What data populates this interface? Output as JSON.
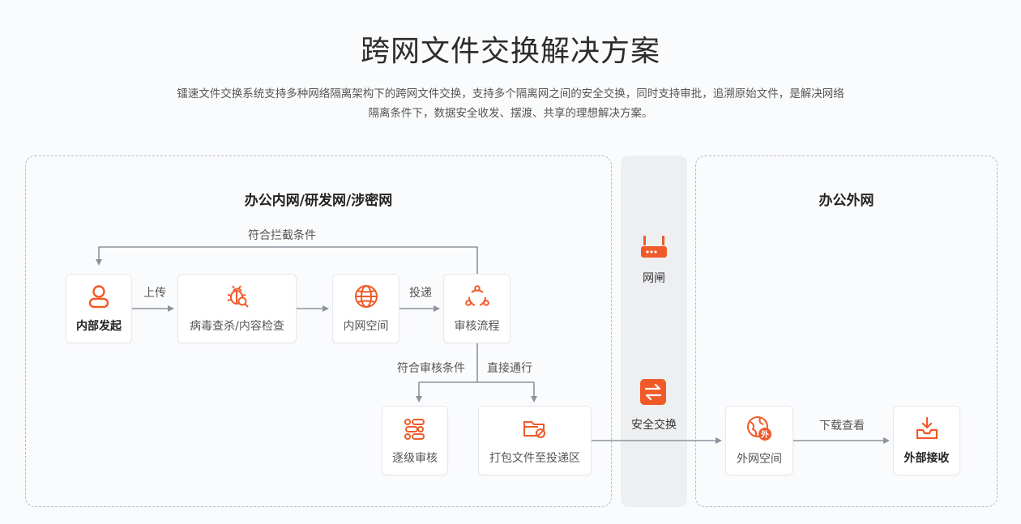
{
  "title": "跨网文件交换解决方案",
  "description_line1": "镭速文件交换系统支持多种网络隔离架构下的跨网文件交换，支持多个隔离网之间的安全交换，同时支持审批，追溯原始文件，是解决网络",
  "description_line2": "隔离条件下，数据安全收发、摆渡、共享的理想解决方案。",
  "colors": {
    "accent": "#f05a28",
    "line": "#8e929b",
    "border": "#b9bcc4"
  },
  "intranet": {
    "title": "办公内网/研发网/涉密网",
    "nodes": {
      "initiate": {
        "label": "内部发起",
        "icon": "user-icon"
      },
      "scan": {
        "label": "病毒查杀/内容检查",
        "icon": "bug-icon"
      },
      "intranet_space": {
        "label": "内网空间",
        "icon": "globe-icon"
      },
      "review": {
        "label": "审核流程",
        "icon": "flow-icon"
      },
      "multi_level": {
        "label": "逐级审核",
        "icon": "levels-icon"
      },
      "package": {
        "label": "打包文件至投递区",
        "icon": "folder-icon"
      }
    },
    "edges": {
      "upload": "上传",
      "deliver": "投递",
      "intercept": "符合拦截条件",
      "meets_review": "符合审核条件",
      "direct_pass": "直接通行"
    }
  },
  "gateway": {
    "gate": {
      "label": "网闸",
      "icon": "router-icon"
    },
    "exchange": {
      "label": "安全交换",
      "icon": "exchange-icon"
    }
  },
  "extranet": {
    "title": "办公外网",
    "nodes": {
      "extranet_space": {
        "label": "外网空间",
        "icon": "globe-outside-icon",
        "badge": "外"
      },
      "receive": {
        "label": "外部接收",
        "icon": "inbox-download-icon"
      }
    },
    "edges": {
      "download_view": "下载查看"
    }
  }
}
